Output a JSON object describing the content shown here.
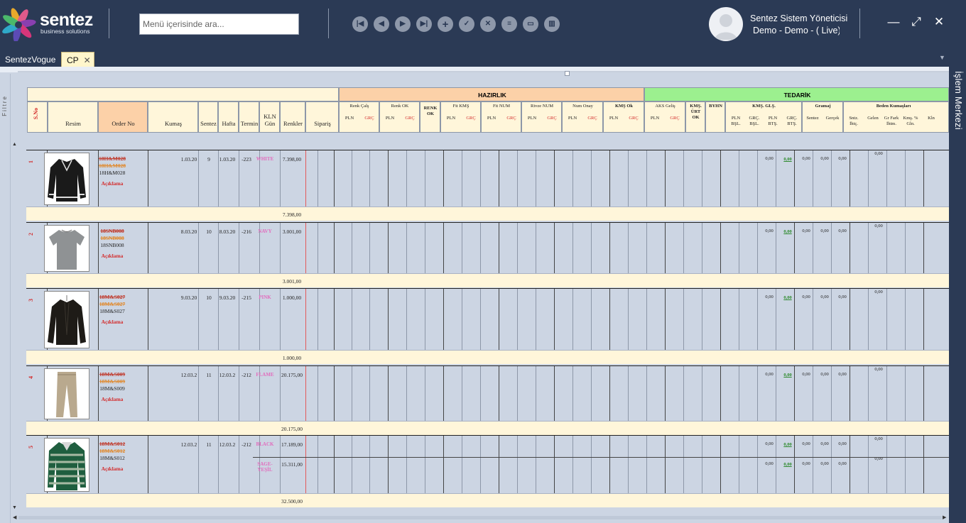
{
  "brand": {
    "name": "sentez",
    "tagline": "business solutions"
  },
  "search": {
    "placeholder": "Menü içerisinde ara..."
  },
  "toolbar": {
    "icons": [
      "first-icon",
      "prev-icon",
      "next-icon",
      "last-icon",
      "add-icon",
      "check-icon",
      "cancel-icon",
      "list-icon",
      "card-icon",
      "trash-icon"
    ]
  },
  "user": {
    "name": "Sentez Sistem Yöneticisi",
    "env": "Demo - Demo - ( Live)"
  },
  "window": {
    "minimize": "—",
    "maximize": "⤢",
    "close": "✕"
  },
  "tabs": [
    {
      "label": "SentezVogue"
    },
    {
      "label": "CP",
      "close": "✕"
    }
  ],
  "side_panel": {
    "label": "İşlem Merkezi"
  },
  "filter": {
    "label": "Filtre"
  },
  "grid": {
    "columns": {
      "sno": "S.No",
      "resim": "Resim",
      "order_no": "Order No",
      "kumas": "Kumaş",
      "sentez": "Sentez",
      "hafta": "Hafta",
      "termin": "Termin",
      "kln_gun": "KLN Gün",
      "renkler": "Renkler",
      "siparis": "Sipariş"
    },
    "groups": {
      "hazirlik": "HAZIRLIK",
      "tedarik": "TEDARİK"
    },
    "hazirlik_sub": [
      {
        "label": "Renk Çalş",
        "a": "PLN",
        "b": "GRÇ"
      },
      {
        "label": "Renk OK",
        "a": "PLN",
        "b": "GRÇ"
      },
      {
        "label": "RENK OK"
      },
      {
        "label": "Fit KMŞ",
        "a": "PLN",
        "b": "GRÇ"
      },
      {
        "label": "Fit NUM",
        "a": "PLN",
        "b": "GRÇ"
      },
      {
        "label": "Rivze NUM",
        "a": "PLN",
        "b": "GRÇ"
      },
      {
        "label": "Num Onay",
        "a": "PLN",
        "b": "GRÇ"
      },
      {
        "label": "KMŞ Ok",
        "a": "PLN",
        "b": "GRÇ"
      }
    ],
    "tedarik_sub": {
      "aks": "AKS Geliş",
      "aks_a": "PLN",
      "aks_b": "GRÇ",
      "kms_urt": "KMŞ. ÜRT OK",
      "byhn": "BYHN",
      "kms_gls": "KMŞ. GLŞ.",
      "kms_gls_cols": [
        "PLN BŞL.",
        "GRÇ. BŞL.",
        "PLN BTŞ.",
        "GRÇ. BTŞ."
      ],
      "gramaj": "Gramaj",
      "gramaj_cols": [
        "Sentez",
        "Gerçek"
      ],
      "beden": "Beden Kumaşları",
      "beden_cols": [
        "Sntz. İhtç.",
        "Gelen",
        "Gr Fark İhtm.",
        "Kmş. % Gln.",
        "Kln"
      ]
    },
    "rows": [
      {
        "sno": "1",
        "orders": [
          "18H&M028",
          "18H&M028",
          "18H&M028"
        ],
        "action": "Açıklama",
        "sentez": "1.03.20",
        "hafta": "9",
        "termin": "1.03.20",
        "kln": "-223",
        "colors": [
          {
            "name": "WHITE",
            "qty": "7.398,00"
          }
        ],
        "zeros": [
          "0,00",
          "0,00",
          "0,00",
          "0,00",
          "0,00"
        ],
        "extra": "0,00",
        "subtotal": "7.398,00",
        "image": "jacket"
      },
      {
        "sno": "2",
        "orders": [
          "18SNB008",
          "18SNB008",
          "18SNB008"
        ],
        "action": "Açıklama",
        "sentez": "8.03.20",
        "hafta": "10",
        "termin": "8.03.20",
        "kln": "-216",
        "colors": [
          {
            "name": "NAVY",
            "qty": "3.001,00"
          }
        ],
        "zeros": [
          "0,00",
          "0,00",
          "0,00",
          "0,00",
          "0,00"
        ],
        "extra": "0,00",
        "subtotal": "3.001,00",
        "image": "tshirt"
      },
      {
        "sno": "3",
        "orders": [
          "18M&S027",
          "18M&S027",
          "18M&S027"
        ],
        "action": "Açıklama",
        "sentez": "9.03.20",
        "hafta": "10",
        "termin": "9.03.20",
        "kln": "-215",
        "colors": [
          {
            "name": "PINK",
            "qty": "1.000,00"
          }
        ],
        "zeros": [
          "0,00",
          "0,00",
          "0,00",
          "0,00",
          "0,00"
        ],
        "extra": "0,00",
        "subtotal": "1.000,00",
        "image": "cardigan"
      },
      {
        "sno": "4",
        "orders": [
          "18M&S009",
          "18M&S009",
          "18M&S009"
        ],
        "action": "Açıklama",
        "sentez": "12.03.2",
        "hafta": "11",
        "termin": "12.03.2",
        "kln": "-212",
        "colors": [
          {
            "name": "FLAME",
            "qty": "20.175,00"
          }
        ],
        "zeros": [
          "0,00",
          "0,00",
          "0,00",
          "0,00",
          "0,00"
        ],
        "extra": "0,00",
        "subtotal": "20.175,00",
        "image": "pants"
      },
      {
        "sno": "5",
        "orders": [
          "18M&S012",
          "18M&S012",
          "18M&S012"
        ],
        "action": "Açıklama",
        "sentez": "12.03.2",
        "hafta": "11",
        "termin": "12.03.2",
        "kln": "-212",
        "colors": [
          {
            "name": "BLACK",
            "qty": "17.189,00"
          },
          {
            "name": "SAGE-YEŞİL",
            "qty": "15.311,00"
          }
        ],
        "zeros": [
          "0,00",
          "0,00",
          "0,00",
          "0,00",
          "0,00"
        ],
        "extra": "0,00",
        "subtotal": "32.500,00",
        "image": "polo"
      }
    ]
  }
}
